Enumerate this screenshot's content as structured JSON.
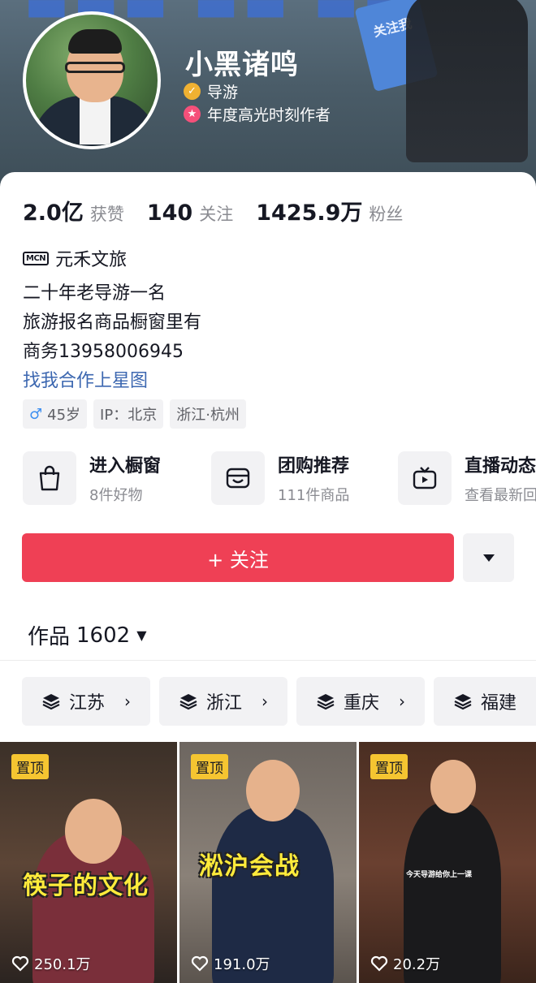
{
  "profile": {
    "name": "小黑诸鸣",
    "badge_1": "导游",
    "badge_2": "年度高光时刻作者",
    "banner_sign": "关注我"
  },
  "stats": [
    {
      "value": "2.0亿",
      "label": "获赞"
    },
    {
      "value": "140",
      "label": "关注"
    },
    {
      "value": "1425.9万",
      "label": "粉丝"
    }
  ],
  "mcn": {
    "icon_text": "MCN",
    "name": "元禾文旅"
  },
  "bio": {
    "line_1": "二十年老导游一名",
    "line_2": "旅游报名商品橱窗里有",
    "line_3": "商务13958006945",
    "link": "找我合作上星图"
  },
  "tags": {
    "gender_symbol": "♂",
    "age": "45岁",
    "ip": "IP：北京",
    "location": "浙江·杭州"
  },
  "shortcuts": [
    {
      "title": "进入橱窗",
      "subtitle": "8件好物",
      "icon": "shopping-bag-icon"
    },
    {
      "title": "团购推荐",
      "subtitle": "111件商品",
      "icon": "group-buy-icon"
    },
    {
      "title": "直播动态",
      "subtitle": "查看最新回",
      "icon": "tv-icon"
    }
  ],
  "actions": {
    "follow": "+ 关注"
  },
  "works": {
    "label": "作品",
    "count": "1602"
  },
  "regions": [
    "江苏",
    "浙江",
    "重庆",
    "福建"
  ],
  "videos": [
    {
      "pin": "置顶",
      "caption": "筷子的文化",
      "likes": "250.1万"
    },
    {
      "pin": "置顶",
      "caption": "淞沪会战",
      "likes": "191.0万"
    },
    {
      "pin": "置顶",
      "caption": "今天导游给你上一课",
      "likes": "20.2万"
    }
  ],
  "colors": {
    "follow_red": "#ef4055",
    "link_blue": "#3c67b0",
    "pin_yellow": "#f5c531"
  }
}
